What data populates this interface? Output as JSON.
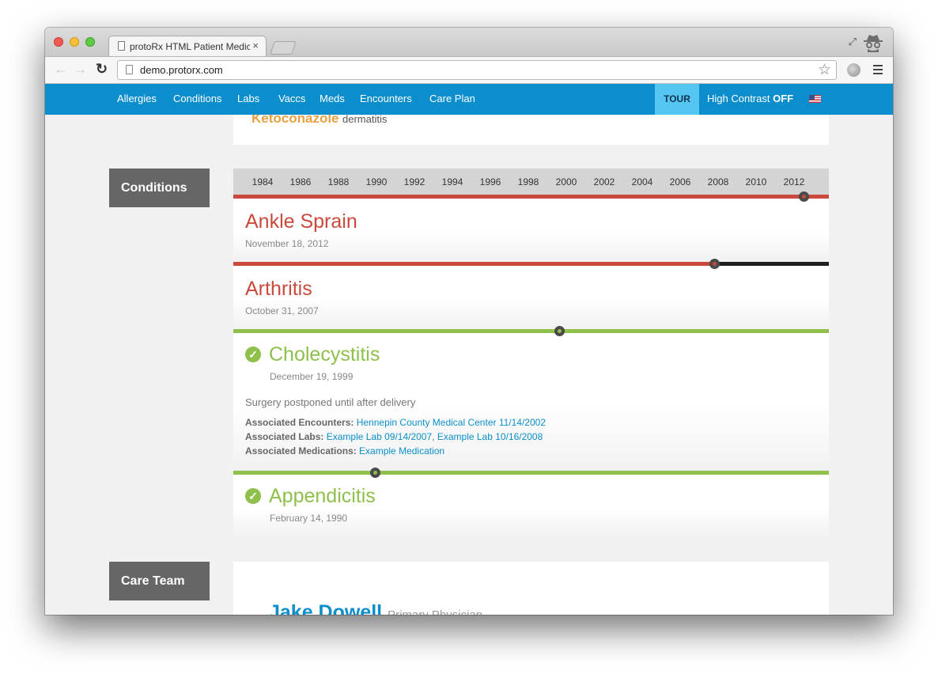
{
  "browser": {
    "tab_title": "protoRx HTML Patient Medical Record",
    "url": "demo.protorx.com",
    "tab_close": "×"
  },
  "nav": {
    "links": [
      "Allergies",
      "Conditions",
      "Labs",
      "Vaccs",
      "Meds",
      "Encounters",
      "Care Plan"
    ],
    "tour": "TOUR",
    "contrast_label": "High Contrast",
    "contrast_state": "OFF",
    "flag": "us-flag-icon"
  },
  "allergy": {
    "name": "Ketoconazole",
    "reaction": "dermatitis"
  },
  "sections": {
    "conditions": "Conditions",
    "care_team": "Care Team"
  },
  "timeline": {
    "years": [
      "1984",
      "1986",
      "1988",
      "1990",
      "1992",
      "1994",
      "1996",
      "1998",
      "2000",
      "2002",
      "2004",
      "2006",
      "2008",
      "2010",
      "2012"
    ]
  },
  "conditions": [
    {
      "title": "Ankle Sprain",
      "date": "November 18, 2012",
      "status": "active",
      "color": "#c94a3d",
      "onset_fraction": 0.958
    },
    {
      "title": "Arthritis",
      "date": "October 31, 2007",
      "status": "active",
      "color": "#c94a3d",
      "onset_fraction": 0.808
    },
    {
      "title": "Cholecystitis",
      "date": "December 19, 1999",
      "status": "resolved",
      "color": "#8ec04b",
      "onset_fraction": 0.548,
      "note": "Surgery postponed until after delivery",
      "encounters_label": "Associated Encounters:",
      "encounters": "Hennepin County Medical Center 11/14/2002",
      "labs_label": "Associated Labs:",
      "lab_1": "Example Lab 09/14/2007",
      "lab_sep": ",",
      "lab_2": "Example Lab 10/16/2008",
      "meds_label": "Associated Medications:",
      "meds": "Example Medication"
    },
    {
      "title": "Appendicitis",
      "date": "February 14, 1990",
      "status": "resolved",
      "color": "#8ec04b",
      "onset_fraction": 0.239
    }
  ],
  "care_team": {
    "name": "Jake Dowell",
    "role": "Primary Physician"
  },
  "colors": {
    "nav": "#0b8ecb",
    "tour": "#55c6f1",
    "active_condition": "#c94a3d",
    "resolved_condition": "#8ec04b",
    "chronic_bar": "#1f1f1f",
    "allergy": "#e8a042"
  }
}
